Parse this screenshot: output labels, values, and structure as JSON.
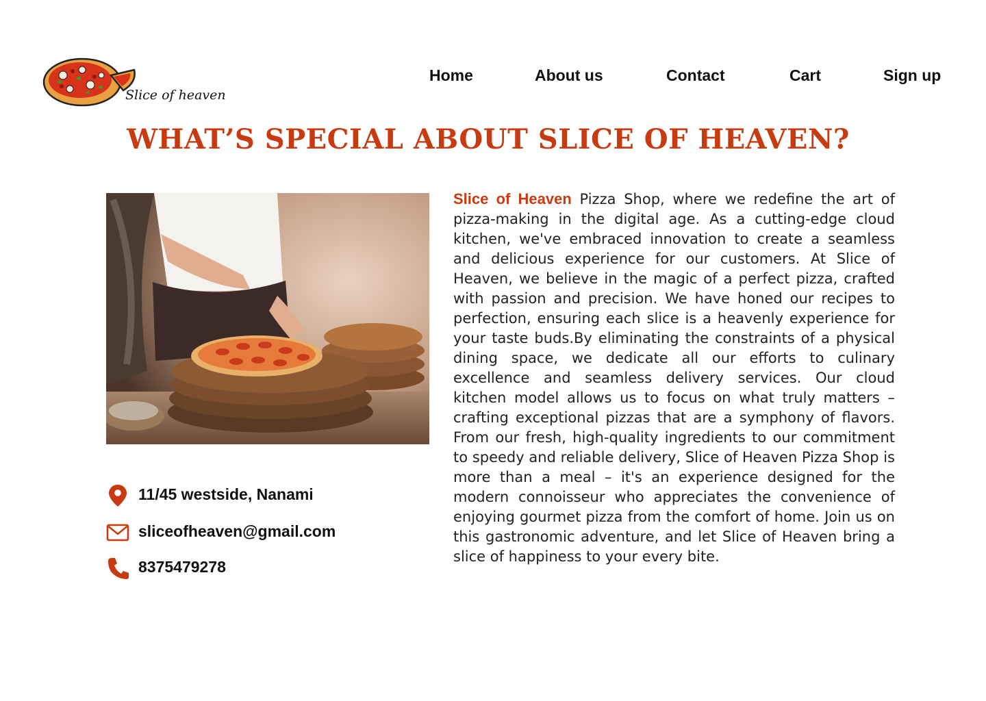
{
  "logo": {
    "text": "Slice of heaven"
  },
  "nav": {
    "home": "Home",
    "about": "About us",
    "contact": "Contact",
    "cart": "Cart",
    "signup": "Sign up"
  },
  "headline": "WHAT’S SPECIAL ABOUT SLICE OF HEAVEN?",
  "about": {
    "brand": "Slice of Heaven",
    "body": " Pizza Shop, where we redefine the art of pizza-making in the digital age. As a cutting-edge cloud kitchen, we've embraced innovation to create a seamless and delicious experience for our customers. At Slice of Heaven, we believe in the magic of a perfect pizza,  crafted with passion and precision. We have honed our recipes to perfection, ensuring each slice is a heavenly experience for your taste buds.By eliminating the constraints of a physical dining space, we dedicate all our efforts to culinary excellence and seamless delivery services. Our cloud kitchen model allows us to focus on what truly matters – crafting exceptional pizzas that are a symphony of flavors. From our fresh, high-quality ingredients to our commitment to speedy and reliable delivery, Slice of Heaven Pizza Shop is more than a meal – it's an experience designed for the modern connoisseur who appreciates the convenience of enjoying gourmet pizza from the comfort of home. Join us on this gastronomic adventure, and let Slice of Heaven bring a slice of happiness to your every bite."
  },
  "contact": {
    "address": "11/45 westside, Nanami",
    "email": "sliceofheaven@gmail.com",
    "phone": "8375479278"
  },
  "icons": {
    "location": "map-pin-icon",
    "email": "envelope-icon",
    "phone": "phone-icon"
  },
  "colors": {
    "accent": "#c83a0f",
    "text": "#111111",
    "background": "#ffffff"
  }
}
